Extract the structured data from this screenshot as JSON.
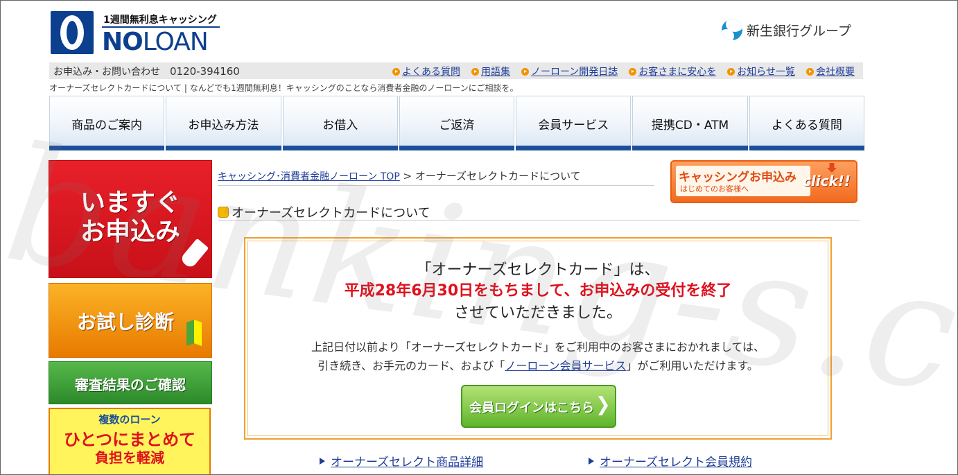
{
  "header": {
    "tagline": "1週間無利息キャッシング",
    "brand_bold": "NO",
    "brand_light": "LOAN",
    "group": "新生銀行グループ"
  },
  "infobar": {
    "contact_label": "お申込み・お問い合わせ",
    "phone": "0120-394160",
    "links": [
      "よくある質問",
      "用語集",
      "ノーローン開発日誌",
      "お客さまに安心を",
      "お知らせ一覧",
      "会社概要"
    ]
  },
  "description": "オーナーズセレクトカードについて | なんどでも1週間無利息！キャッシングのことなら消費者金融のノーローンにご相談を。",
  "gnav": [
    "商品のご案内",
    "お申込み方法",
    "お借入",
    "ご返済",
    "会員サービス",
    "提携CD・ATM",
    "よくある質問"
  ],
  "sidebar": {
    "apply_now_line1": "いますぐ",
    "apply_now_line2": "お申込み",
    "trial": "お試し診断",
    "check_result": "審査結果のご確認",
    "consolidate_1": "複数のローン",
    "consolidate_2": "ひとつにまとめて",
    "consolidate_3": "負担を軽減"
  },
  "breadcrumb": {
    "home": "キャッシング･消費者金融ノーローン TOP",
    "sep": " > ",
    "current": "オーナーズセレクトカードについて"
  },
  "cta": {
    "title": "キャッシングお申込み",
    "sub": "はじめてのお客様へ",
    "click": "click!!"
  },
  "heading": "オーナーズセレクトカードについて",
  "notice": {
    "line1": "「オーナーズセレクトカード」は、",
    "line2": "平成28年6月30日をもちまして、お申込みの受付を終了",
    "line3": "させていただきました。",
    "body1": "上記日付以前より「オーナーズセレクトカード」をご利用中のお客さまにおかれましては、",
    "body2_pre": "引き続き、お手元のカード、および「",
    "body2_link": "ノーローン会員サービス",
    "body2_post": "」がご利用いただけます。",
    "login": "会員ログインはこちら"
  },
  "bottom_links": [
    "オーナーズセレクト商品詳細",
    "オーナーズセレクト会員規約"
  ],
  "watermark": "banking-s.com",
  "colors": {
    "brand_blue": "#0d3f8f",
    "link": "#1f3d99",
    "notice_red": "#e0101c",
    "accent_orange": "#f29400"
  }
}
